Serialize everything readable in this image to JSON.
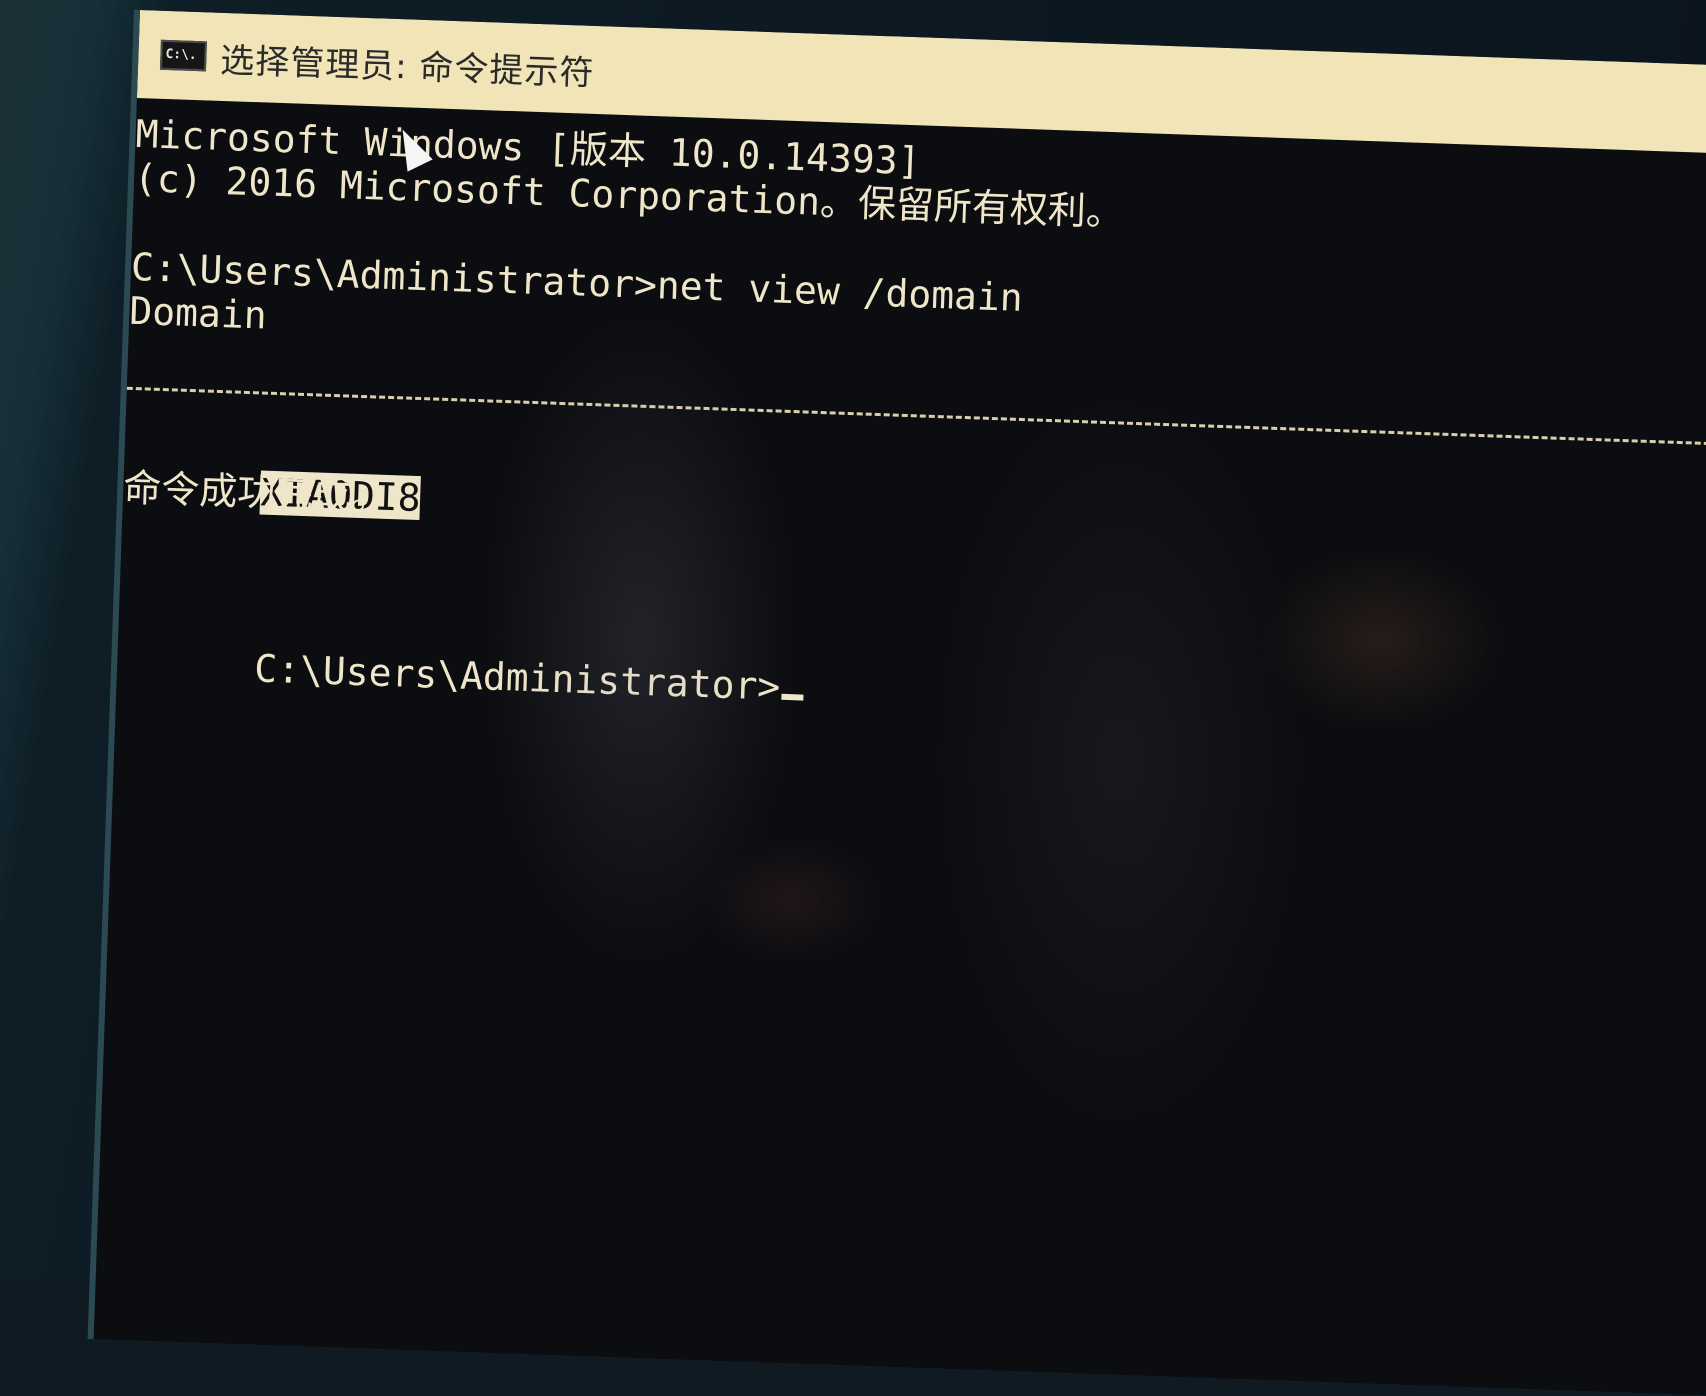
{
  "window": {
    "icon_label": "C:\\.",
    "title": "选择管理员: 命令提示符"
  },
  "console": {
    "lines": [
      "Microsoft Windows [版本 10.0.14393]",
      "(c) 2016 Microsoft Corporation。保留所有权利。",
      "",
      "C:\\Users\\Administrator>net view /domain",
      "Domain"
    ],
    "selected_domain": "XIAODI8",
    "status": "命令成功完成。",
    "prompt": "C:\\Users\\Administrator>"
  }
}
